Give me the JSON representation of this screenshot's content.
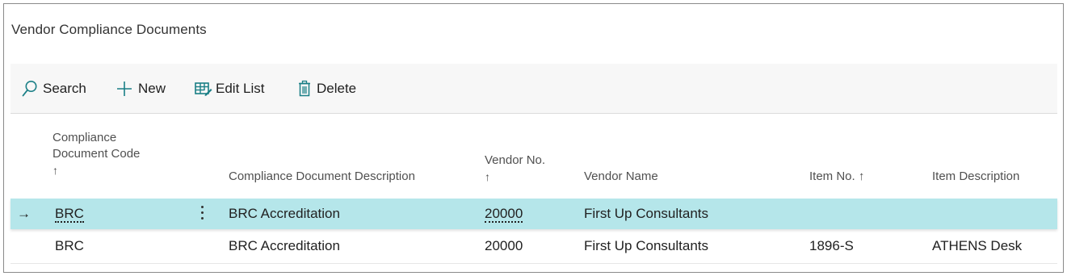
{
  "page": {
    "title": "Vendor Compliance Documents"
  },
  "actions": {
    "search": {
      "label": "Search",
      "icon": "search-icon"
    },
    "new": {
      "label": "New",
      "icon": "plus-icon"
    },
    "edit_list": {
      "label": "Edit List",
      "icon": "edit-list-icon"
    },
    "delete": {
      "label": "Delete",
      "icon": "trash-icon"
    }
  },
  "columns": {
    "code": {
      "line1": "Compliance",
      "line2": "Document Code",
      "sort": "↑"
    },
    "description": {
      "label": "Compliance Document Description"
    },
    "vendor_no": {
      "label": "Vendor No.",
      "sort": "↑"
    },
    "vendor_name": {
      "label": "Vendor Name"
    },
    "item_no": {
      "label": "Item No. ↑"
    },
    "item_description": {
      "label": "Item Description"
    }
  },
  "rows": [
    {
      "selected": true,
      "indicator": "→",
      "code": "BRC",
      "description": "BRC Accreditation",
      "vendor_no": "20000",
      "vendor_name": "First Up Consultants",
      "item_no": "",
      "item_description": ""
    },
    {
      "selected": false,
      "indicator": "",
      "code": "BRC",
      "description": "BRC Accreditation",
      "vendor_no": "20000",
      "vendor_name": "First Up Consultants",
      "item_no": "1896-S",
      "item_description": "ATHENS Desk"
    }
  ],
  "colors": {
    "selected_row": "#b5e6ea",
    "accent": "#1a7f86",
    "action_bar": "#f7f7f7"
  }
}
